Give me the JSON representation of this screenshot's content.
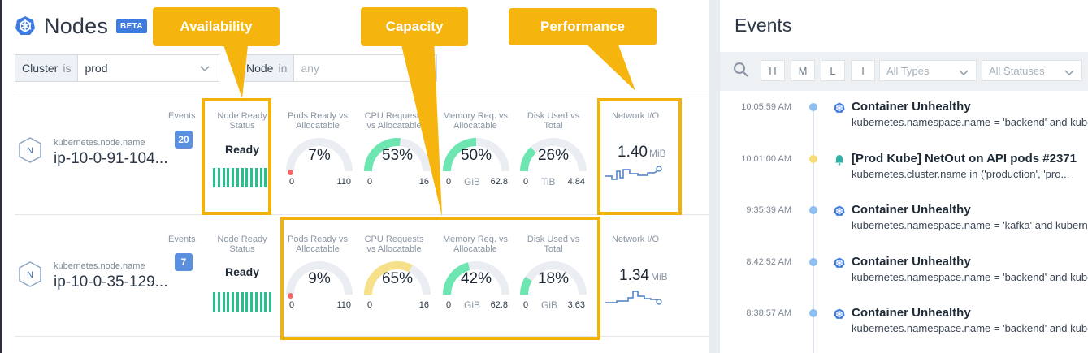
{
  "header": {
    "title": "Nodes",
    "badge": "BETA"
  },
  "filters": [
    {
      "key": "Cluster",
      "operator": "is",
      "value": "prod"
    },
    {
      "key": "Node",
      "operator": "in",
      "value": "any"
    }
  ],
  "callouts": {
    "availability": "Availability",
    "capacity": "Capacity",
    "performance": "Performance"
  },
  "columns": {
    "events": "Events",
    "ready_status": [
      "Node Ready",
      "Status"
    ],
    "pods": [
      "Pods Ready vs",
      "Allocatable"
    ],
    "cpu": [
      "CPU Requests",
      "vs Allocatable"
    ],
    "memory": [
      "Memory Req. vs",
      "Allocatable"
    ],
    "disk": [
      "Disk Used vs",
      "Total"
    ],
    "network": "Network I/O"
  },
  "nodes": [
    {
      "key": "kubernetes.node.name",
      "name": "ip-10-0-91-104...",
      "events": "20",
      "status": "Ready",
      "pods": {
        "pct": "7%",
        "value": 0.07,
        "min": "0",
        "max": "110",
        "unit": ""
      },
      "cpu": {
        "pct": "53%",
        "value": 0.53,
        "min": "0",
        "max": "16",
        "unit": ""
      },
      "memory": {
        "pct": "50%",
        "value": 0.5,
        "min": "0",
        "max": "62.8",
        "unit": "GiB"
      },
      "disk": {
        "pct": "26%",
        "value": 0.26,
        "min": "0",
        "max": "4.84",
        "unit": "TiB"
      },
      "network": {
        "value": "1.40",
        "unit": "MiB"
      }
    },
    {
      "key": "kubernetes.node.name",
      "name": "ip-10-0-35-129...",
      "events": "7",
      "status": "Ready",
      "pods": {
        "pct": "9%",
        "value": 0.09,
        "min": "0",
        "max": "110",
        "unit": ""
      },
      "cpu": {
        "pct": "65%",
        "value": 0.65,
        "min": "0",
        "max": "16",
        "unit": ""
      },
      "memory": {
        "pct": "42%",
        "value": 0.42,
        "min": "0",
        "max": "62.8",
        "unit": "GiB"
      },
      "disk": {
        "pct": "18%",
        "value": 0.18,
        "min": "0",
        "max": "3.63",
        "unit": "GiB"
      },
      "network": {
        "value": "1.34",
        "unit": "MiB"
      }
    }
  ],
  "events_panel": {
    "title": "Events",
    "severity": [
      "H",
      "M",
      "L",
      "I"
    ],
    "types_placeholder": "All Types",
    "statuses_placeholder": "All Statuses",
    "items": [
      {
        "time": "10:05:59 AM",
        "name": "Container Unhealthy",
        "desc": "kubernetes.namespace.name = 'backend' and kube",
        "icon": "kubernetes-icon",
        "dot": "#8fbff0"
      },
      {
        "time": "10:01:00 AM",
        "name": "[Prod Kube] NetOut on API pods #2371",
        "desc": "kubernetes.cluster.name in ('production', 'pro...",
        "icon": "bell-icon",
        "dot": "#f5dd78"
      },
      {
        "time": "9:35:39 AM",
        "name": "Container Unhealthy",
        "desc": "kubernetes.namespace.name = 'kafka' and kuberne",
        "icon": "kubernetes-icon",
        "dot": "#8fbff0"
      },
      {
        "time": "8:42:52 AM",
        "name": "Container Unhealthy",
        "desc": "kubernetes.namespace.name = 'backend' and kube",
        "icon": "kubernetes-icon",
        "dot": "#8fbff0"
      },
      {
        "time": "8:38:57 AM",
        "name": "Container Unhealthy",
        "desc": "kubernetes.namespace.name = 'backend' and kube",
        "icon": "kubernetes-icon",
        "dot": "#8fbff0"
      }
    ]
  },
  "colors": {
    "accent": "#3d7be0",
    "highlight": "#f1b20b",
    "ok": "#27c08a",
    "gauge_green": "#6ee6b2",
    "gauge_yellow": "#f7e08a",
    "gauge_track": "#eaedf1"
  }
}
